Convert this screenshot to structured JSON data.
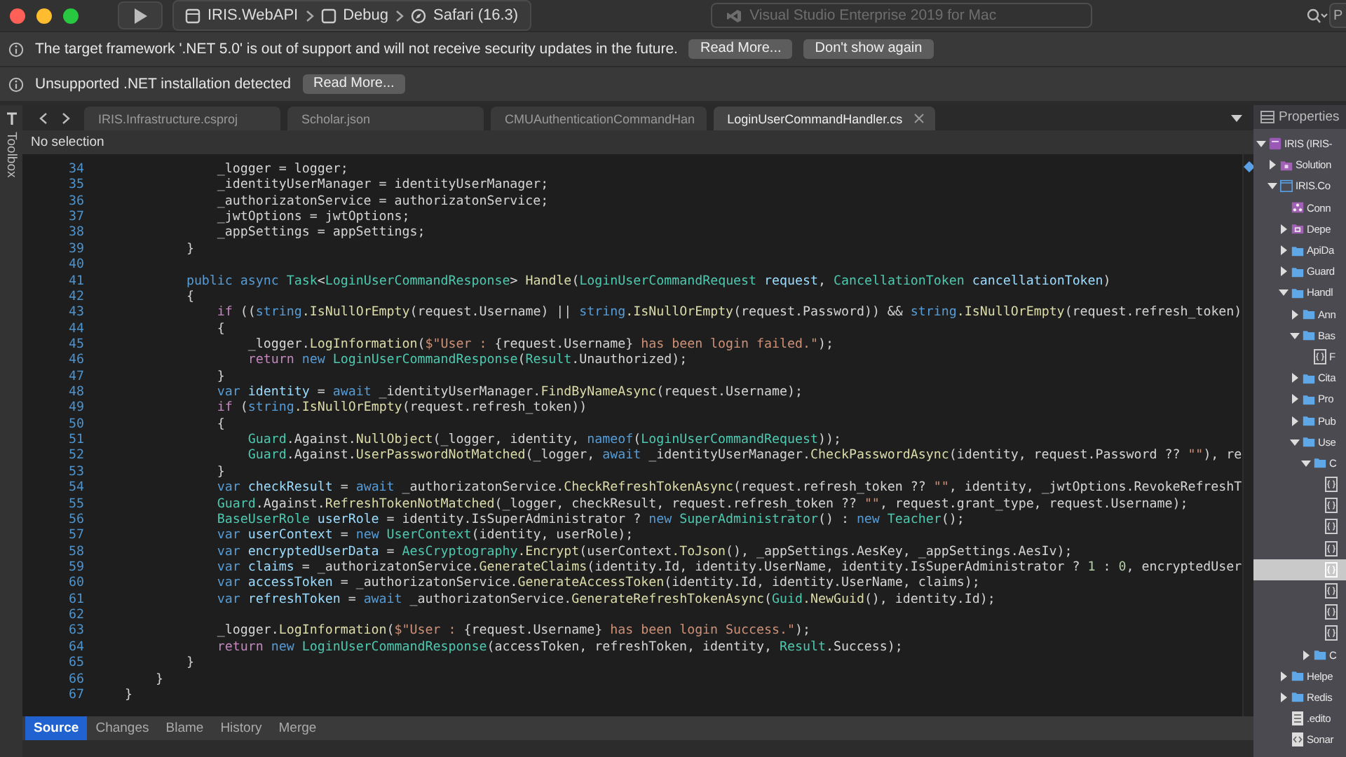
{
  "window": {
    "title": "Visual Studio Enterprise 2019 for Mac"
  },
  "toolbar": {
    "breadcrumb": [
      {
        "kind": "project",
        "label": "IRIS.WebAPI"
      },
      {
        "kind": "config",
        "label": "Debug"
      },
      {
        "kind": "browser",
        "label": "Safari (16.3)"
      }
    ],
    "search": {
      "placeholder": "P"
    }
  },
  "notifications": [
    {
      "message": "The target framework '.NET 5.0' is out of support and will not receive security updates in the future.",
      "buttons": [
        "Read More...",
        "Don't show again"
      ]
    },
    {
      "message": "Unsupported .NET installation detected",
      "buttons": [
        "Read More..."
      ]
    }
  ],
  "toolbox": {
    "label": "Toolbox"
  },
  "editor_tabs": [
    {
      "label": "IRIS.Infrastructure.csproj",
      "selected": false
    },
    {
      "label": "Scholar.json",
      "selected": false
    },
    {
      "label": "CMUAuthenticationCommandHan",
      "selected": false
    },
    {
      "label": "LoginUserCommandHandler.cs",
      "selected": true
    }
  ],
  "selection_status": "No selection",
  "code_lines": [
    {
      "number": "34",
      "tokens": [
        {
          "kind": "plain",
          "text": "            _logger = logger;"
        }
      ]
    },
    {
      "number": "35",
      "tokens": [
        {
          "kind": "plain",
          "text": "            _identityUserManager = identityUserManager;"
        }
      ]
    },
    {
      "number": "36",
      "tokens": [
        {
          "kind": "plain",
          "text": "            _authorizatonService = authorizatonService;"
        }
      ]
    },
    {
      "number": "37",
      "tokens": [
        {
          "kind": "plain",
          "text": "            _jwtOptions = jwtOptions;"
        }
      ]
    },
    {
      "number": "38",
      "tokens": [
        {
          "kind": "plain",
          "text": "            _appSettings = appSettings;"
        }
      ]
    },
    {
      "number": "39",
      "tokens": [
        {
          "kind": "plain",
          "text": "        }"
        }
      ]
    },
    {
      "number": "40"
    },
    {
      "number": "41",
      "tokens": [
        {
          "kind": "keyword",
          "text": "        public async "
        },
        {
          "kind": "type",
          "text": "Task"
        },
        {
          "kind": "plain",
          "text": "<"
        },
        {
          "kind": "type",
          "text": "LoginUserCommandResponse"
        },
        {
          "kind": "plain",
          "text": "> "
        },
        {
          "kind": "method",
          "text": "Handle"
        },
        {
          "kind": "plain",
          "text": "("
        },
        {
          "kind": "type",
          "text": "LoginUserCommandRequest"
        },
        {
          "kind": "variable",
          "text": " request"
        },
        {
          "kind": "plain",
          "text": ", "
        },
        {
          "kind": "type",
          "text": "CancellationToken"
        },
        {
          "kind": "variable",
          "text": " cancellationToken"
        },
        {
          "kind": "plain",
          "text": ")"
        }
      ]
    },
    {
      "number": "42",
      "tokens": [
        {
          "kind": "plain",
          "text": "        {"
        }
      ]
    },
    {
      "number": "43",
      "tokens": [
        {
          "kind": "control",
          "text": "            if"
        },
        {
          "kind": "plain",
          "text": " (("
        },
        {
          "kind": "keyword",
          "text": "string"
        },
        {
          "kind": "method",
          "text": ".IsNullOrEmpty"
        },
        {
          "kind": "plain",
          "text": "(request.Username) || "
        },
        {
          "kind": "keyword",
          "text": "string"
        },
        {
          "kind": "method",
          "text": ".IsNullOrEmpty"
        },
        {
          "kind": "plain",
          "text": "(request.Password)) && "
        },
        {
          "kind": "keyword",
          "text": "string"
        },
        {
          "kind": "method",
          "text": ".IsNullOrEmpty"
        },
        {
          "kind": "plain",
          "text": "(request.refresh_token)"
        }
      ]
    },
    {
      "number": "44",
      "tokens": [
        {
          "kind": "plain",
          "text": "            {"
        }
      ]
    },
    {
      "number": "45",
      "tokens": [
        {
          "kind": "plain",
          "text": "                _logger."
        },
        {
          "kind": "method",
          "text": "LogInformation"
        },
        {
          "kind": "plain",
          "text": "("
        },
        {
          "kind": "string",
          "text": "$\"User : "
        },
        {
          "kind": "plain",
          "text": "{request.Username}"
        },
        {
          "kind": "string",
          "text": " has been login failed.\""
        },
        {
          "kind": "plain",
          "text": ");"
        }
      ]
    },
    {
      "number": "46",
      "tokens": [
        {
          "kind": "control",
          "text": "                return"
        },
        {
          "kind": "keyword",
          "text": " new"
        },
        {
          "kind": "type",
          "text": " LoginUserCommandResponse"
        },
        {
          "kind": "plain",
          "text": "("
        },
        {
          "kind": "type",
          "text": "Result"
        },
        {
          "kind": "plain",
          "text": ".Unauthorized);"
        }
      ]
    },
    {
      "number": "47",
      "tokens": [
        {
          "kind": "plain",
          "text": "            }"
        }
      ]
    },
    {
      "number": "48",
      "tokens": [
        {
          "kind": "keyword",
          "text": "            var"
        },
        {
          "kind": "variable",
          "text": " identity"
        },
        {
          "kind": "plain",
          "text": " = "
        },
        {
          "kind": "keyword",
          "text": "await"
        },
        {
          "kind": "plain",
          "text": " _identityUserManager."
        },
        {
          "kind": "method",
          "text": "FindByNameAsync"
        },
        {
          "kind": "plain",
          "text": "(request.Username);"
        }
      ]
    },
    {
      "number": "49",
      "tokens": [
        {
          "kind": "control",
          "text": "            if"
        },
        {
          "kind": "plain",
          "text": " ("
        },
        {
          "kind": "keyword",
          "text": "string"
        },
        {
          "kind": "method",
          "text": ".IsNullOrEmpty"
        },
        {
          "kind": "plain",
          "text": "(request.refresh_token))"
        }
      ]
    },
    {
      "number": "50",
      "tokens": [
        {
          "kind": "plain",
          "text": "            {"
        }
      ]
    },
    {
      "number": "51",
      "tokens": [
        {
          "kind": "type",
          "text": "                Guard"
        },
        {
          "kind": "plain",
          "text": ".Against."
        },
        {
          "kind": "method",
          "text": "NullObject"
        },
        {
          "kind": "plain",
          "text": "(_logger, identity, "
        },
        {
          "kind": "keyword",
          "text": "nameof"
        },
        {
          "kind": "plain",
          "text": "("
        },
        {
          "kind": "type",
          "text": "LoginUserCommandRequest"
        },
        {
          "kind": "plain",
          "text": "));"
        }
      ]
    },
    {
      "number": "52",
      "tokens": [
        {
          "kind": "type",
          "text": "                Guard"
        },
        {
          "kind": "plain",
          "text": ".Against."
        },
        {
          "kind": "method",
          "text": "UserPasswordNotMatched"
        },
        {
          "kind": "plain",
          "text": "(_logger, "
        },
        {
          "kind": "keyword",
          "text": "await"
        },
        {
          "kind": "plain",
          "text": " _identityUserManager."
        },
        {
          "kind": "method",
          "text": "CheckPasswordAsync"
        },
        {
          "kind": "plain",
          "text": "(identity, request.Password ?? "
        },
        {
          "kind": "string",
          "text": "\"\""
        },
        {
          "kind": "plain",
          "text": "), re"
        }
      ]
    },
    {
      "number": "53",
      "tokens": [
        {
          "kind": "plain",
          "text": "            }"
        }
      ]
    },
    {
      "number": "54",
      "tokens": [
        {
          "kind": "keyword",
          "text": "            var"
        },
        {
          "kind": "variable",
          "text": " checkResult"
        },
        {
          "kind": "plain",
          "text": " = "
        },
        {
          "kind": "keyword",
          "text": "await"
        },
        {
          "kind": "plain",
          "text": " _authorizatonService."
        },
        {
          "kind": "method",
          "text": "CheckRefreshTokenAsync"
        },
        {
          "kind": "plain",
          "text": "(request.refresh_token ?? "
        },
        {
          "kind": "string",
          "text": "\"\""
        },
        {
          "kind": "plain",
          "text": ", identity, _jwtOptions.RevokeRefreshT"
        }
      ]
    },
    {
      "number": "55",
      "tokens": [
        {
          "kind": "type",
          "text": "            Guard"
        },
        {
          "kind": "plain",
          "text": ".Against."
        },
        {
          "kind": "method",
          "text": "RefreshTokenNotMatched"
        },
        {
          "kind": "plain",
          "text": "(_logger, checkResult, request.refresh_token ?? "
        },
        {
          "kind": "string",
          "text": "\"\""
        },
        {
          "kind": "plain",
          "text": ", request.grant_type, request.Username);"
        }
      ]
    },
    {
      "number": "56",
      "tokens": [
        {
          "kind": "type",
          "text": "            BaseUserRole"
        },
        {
          "kind": "variable",
          "text": " userRole"
        },
        {
          "kind": "plain",
          "text": " = identity.IsSuperAdministrator ? "
        },
        {
          "kind": "keyword",
          "text": "new"
        },
        {
          "kind": "type",
          "text": " SuperAdministrator"
        },
        {
          "kind": "plain",
          "text": "() : "
        },
        {
          "kind": "keyword",
          "text": "new"
        },
        {
          "kind": "type",
          "text": " Teacher"
        },
        {
          "kind": "plain",
          "text": "();"
        }
      ]
    },
    {
      "number": "57",
      "tokens": [
        {
          "kind": "keyword",
          "text": "            var"
        },
        {
          "kind": "variable",
          "text": " userContext"
        },
        {
          "kind": "plain",
          "text": " = "
        },
        {
          "kind": "keyword",
          "text": "new"
        },
        {
          "kind": "type",
          "text": " UserContext"
        },
        {
          "kind": "plain",
          "text": "(identity, userRole);"
        }
      ]
    },
    {
      "number": "58",
      "tokens": [
        {
          "kind": "keyword",
          "text": "            var"
        },
        {
          "kind": "variable",
          "text": " encryptedUserData"
        },
        {
          "kind": "plain",
          "text": " = "
        },
        {
          "kind": "type",
          "text": "AesCryptography"
        },
        {
          "kind": "method",
          "text": ".Encrypt"
        },
        {
          "kind": "plain",
          "text": "(userContext"
        },
        {
          "kind": "method",
          "text": ".ToJson"
        },
        {
          "kind": "plain",
          "text": "(), _appSettings.AesKey, _appSettings.AesIv);"
        }
      ]
    },
    {
      "number": "59",
      "tokens": [
        {
          "kind": "keyword",
          "text": "            var"
        },
        {
          "kind": "variable",
          "text": " claims"
        },
        {
          "kind": "plain",
          "text": " = _authorizatonService."
        },
        {
          "kind": "method",
          "text": "GenerateClaims"
        },
        {
          "kind": "plain",
          "text": "(identity.Id, identity.UserName, identity.IsSuperAdministrator ? "
        },
        {
          "kind": "number",
          "text": "1"
        },
        {
          "kind": "plain",
          "text": " : "
        },
        {
          "kind": "number",
          "text": "0"
        },
        {
          "kind": "plain",
          "text": ", encryptedUser"
        }
      ]
    },
    {
      "number": "60",
      "tokens": [
        {
          "kind": "keyword",
          "text": "            var"
        },
        {
          "kind": "variable",
          "text": " accessToken"
        },
        {
          "kind": "plain",
          "text": " = _authorizatonService."
        },
        {
          "kind": "method",
          "text": "GenerateAccessToken"
        },
        {
          "kind": "plain",
          "text": "(identity.Id, identity.UserName, claims);"
        }
      ]
    },
    {
      "number": "61",
      "tokens": [
        {
          "kind": "keyword",
          "text": "            var"
        },
        {
          "kind": "variable",
          "text": " refreshToken"
        },
        {
          "kind": "plain",
          "text": " = "
        },
        {
          "kind": "keyword",
          "text": "await"
        },
        {
          "kind": "plain",
          "text": " _authorizatonService."
        },
        {
          "kind": "method",
          "text": "GenerateRefreshTokenAsync"
        },
        {
          "kind": "plain",
          "text": "("
        },
        {
          "kind": "type",
          "text": "Guid"
        },
        {
          "kind": "method",
          "text": ".NewGuid"
        },
        {
          "kind": "plain",
          "text": "(), identity.Id);"
        }
      ]
    },
    {
      "number": "62"
    },
    {
      "number": "63",
      "tokens": [
        {
          "kind": "plain",
          "text": "            _logger."
        },
        {
          "kind": "method",
          "text": "LogInformation"
        },
        {
          "kind": "plain",
          "text": "("
        },
        {
          "kind": "string",
          "text": "$\"User : "
        },
        {
          "kind": "plain",
          "text": "{request.Username}"
        },
        {
          "kind": "string",
          "text": " has been login Success.\""
        },
        {
          "kind": "plain",
          "text": ");"
        }
      ]
    },
    {
      "number": "64",
      "tokens": [
        {
          "kind": "control",
          "text": "            return"
        },
        {
          "kind": "keyword",
          "text": " new"
        },
        {
          "kind": "type",
          "text": " LoginUserCommandResponse"
        },
        {
          "kind": "plain",
          "text": "(accessToken, refreshToken, identity, "
        },
        {
          "kind": "type",
          "text": "Result"
        },
        {
          "kind": "plain",
          "text": ".Success);"
        }
      ]
    },
    {
      "number": "65",
      "tokens": [
        {
          "kind": "plain",
          "text": "        }"
        }
      ]
    },
    {
      "number": "66",
      "tokens": [
        {
          "kind": "plain",
          "text": "    }"
        }
      ]
    },
    {
      "number": "67",
      "tokens": [
        {
          "kind": "plain",
          "text": "}"
        }
      ]
    }
  ],
  "bottom_tabs": [
    {
      "label": "Source",
      "selected": true
    },
    {
      "label": "Changes",
      "selected": false
    },
    {
      "label": "Blame",
      "selected": false
    },
    {
      "label": "History",
      "selected": false
    },
    {
      "label": "Merge",
      "selected": false
    }
  ],
  "properties_panel": {
    "title": "Properties",
    "tree": [
      {
        "kind": "solution",
        "label": "IRIS (IRIS-",
        "expanded": true,
        "selected": false,
        "children": [
          {
            "kind": "solution-folder",
            "label": "Solution",
            "expanded": false,
            "selected": false
          },
          {
            "kind": "project",
            "label": "IRIS.Co",
            "expanded": true,
            "selected": false,
            "children": [
              {
                "kind": "connected",
                "label": "Conn",
                "selected": false
              },
              {
                "kind": "dependencies",
                "label": "Depe",
                "expanded": false,
                "selected": false
              },
              {
                "kind": "folder",
                "label": "ApiDa",
                "expanded": false,
                "selected": false
              },
              {
                "kind": "folder",
                "label": "Guard",
                "expanded": false,
                "selected": false
              },
              {
                "kind": "folder",
                "label": "Handl",
                "expanded": true,
                "selected": false,
                "children": [
                  {
                    "kind": "folder",
                    "label": "Ann",
                    "expanded": false,
                    "selected": false
                  },
                  {
                    "kind": "folder",
                    "label": "Bas",
                    "expanded": true,
                    "selected": false,
                    "children": [
                      {
                        "kind": "file",
                        "label": "F",
                        "selected": false
                      }
                    ]
                  },
                  {
                    "kind": "folder",
                    "label": "Cita",
                    "expanded": false,
                    "selected": false
                  },
                  {
                    "kind": "folder",
                    "label": "Pro",
                    "expanded": false,
                    "selected": false
                  },
                  {
                    "kind": "folder",
                    "label": "Pub",
                    "expanded": false,
                    "selected": false
                  },
                  {
                    "kind": "folder",
                    "label": "Use",
                    "expanded": true,
                    "selected": false,
                    "children": [
                      {
                        "kind": "folder",
                        "label": "C",
                        "expanded": true,
                        "selected": false,
                        "children": [
                          {
                            "kind": "file",
                            "selected": false
                          },
                          {
                            "kind": "file",
                            "selected": false
                          },
                          {
                            "kind": "file",
                            "selected": false
                          },
                          {
                            "kind": "file",
                            "selected": false
                          },
                          {
                            "kind": "file",
                            "selected": true
                          },
                          {
                            "kind": "file",
                            "selected": false
                          },
                          {
                            "kind": "file",
                            "selected": false
                          },
                          {
                            "kind": "file",
                            "selected": false
                          }
                        ]
                      },
                      {
                        "kind": "folder",
                        "label": "C",
                        "expanded": false,
                        "selected": false
                      }
                    ]
                  }
                ]
              },
              {
                "kind": "folder",
                "label": "Helpe",
                "expanded": false,
                "selected": false
              },
              {
                "kind": "folder",
                "label": "Redis",
                "expanded": false,
                "selected": false
              },
              {
                "kind": "document",
                "label": ".edito",
                "selected": false
              },
              {
                "kind": "xml",
                "label": "Sonar",
                "selected": false
              }
            ]
          }
        ]
      }
    ]
  }
}
